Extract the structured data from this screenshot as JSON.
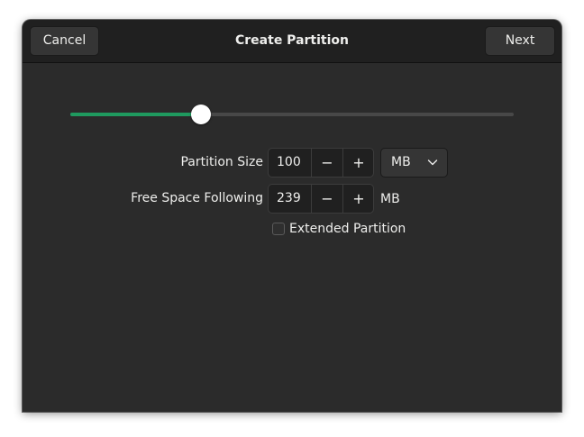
{
  "headerbar": {
    "cancel_label": "Cancel",
    "title": "Create Partition",
    "next_label": "Next"
  },
  "size_slider": {
    "value_fraction": 0.295,
    "accent_color": "#1f9a5f"
  },
  "partition_size": {
    "label": "Partition Size",
    "value": "100",
    "minus": "−",
    "plus": "+",
    "unit_selected": "MB"
  },
  "free_space": {
    "label": "Free Space Following",
    "value": "239",
    "minus": "−",
    "plus": "+",
    "unit": "MB"
  },
  "extended_partition": {
    "label": "Extended Partition",
    "checked": false
  },
  "icons": {
    "unit_dropdown": "chevron-down-icon"
  }
}
